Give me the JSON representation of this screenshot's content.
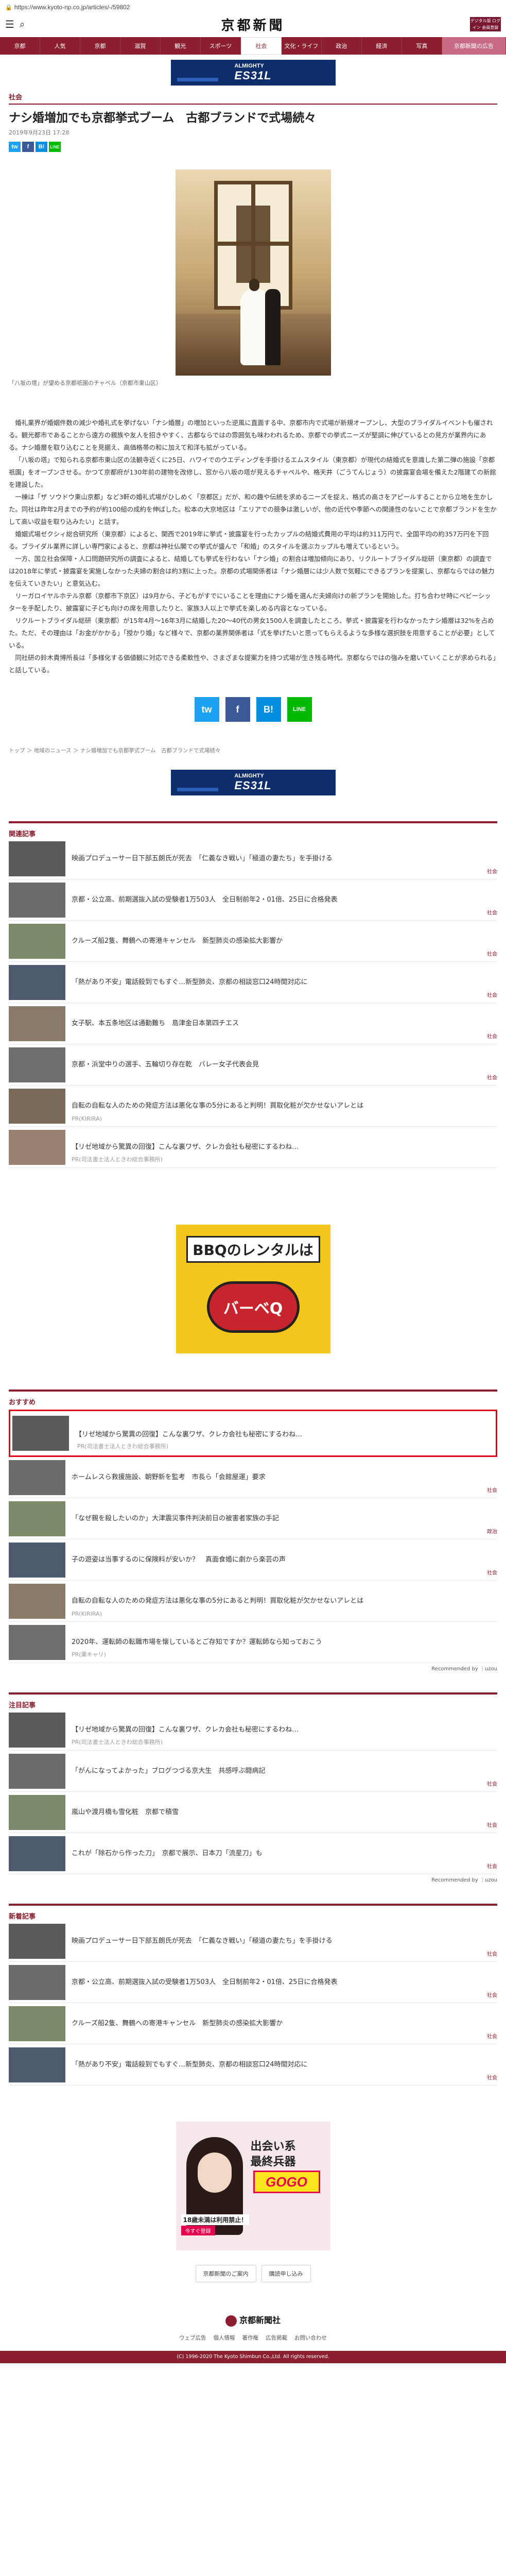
{
  "browser": {
    "url": "https://www.kyoto-np.co.jp/articles/-/59802"
  },
  "header": {
    "logo": "京都新聞",
    "digital": "デジタル版 ログイン 会員登録"
  },
  "nav": [
    "京都",
    "人気",
    "京都",
    "滋賀",
    "観光",
    "スポーツ",
    "社会",
    "文化・ライフ",
    "政治",
    "経済",
    "写真",
    "京都新聞の広告"
  ],
  "ad_top": {
    "line1": "ALMIGHTY",
    "line2": "ES31L"
  },
  "article": {
    "category": "社会",
    "title": "ナシ婚増加でも京都挙式ブーム　古都ブランドで式場続々",
    "date": "2019年9月23日 17:28",
    "share": [
      "tw",
      "f",
      "B!",
      "LINE"
    ],
    "caption": "「八坂の塔」が望める京都祇園のチャペル（京都市東山区）",
    "paragraphs": [
      "婚礼業界が婚姻件数の減少や婚礼式を挙げない「ナシ婚層」の増加といった逆風に直面する中、京都市内で式場が新規オープンし、大型のブライダルイベントも催される。観光都市であることから遠方の親族や友人を招きやすく、古都ならではの雰囲気も味わわれるため、京都での挙式ニーズが堅調に伸びているとの見方が業界内にある。ナシ婚層を取り込むことを見据え、高価格帯の和に加えて和洋も拡がっている。",
      "「八坂の塔」で知られる京都市東山区の法観寺近くに25日、ハワイでのウエディングを手掛けるエムスタイル（東京都）が現代の結婚式を意識した第二弾の施設「京都祇園」をオープンさせる。かつて京都府が130年前の建物を改修し、窓から八坂の塔が見えるチャペルや、格天井（ごうてんじょう）の披露宴会場を備えた2階建ての新館を建設した。",
      "一棟は「ザ ソウドウ東山京都」など3軒の婚礼式場がひしめく「京都区」だが、和の趣や伝統を求めるニーズを捉え、格式の高さをアピールすることから立地を生かした。同社は昨年2月までの予約が約100組の成約を伸ばした。松本の大京地区は「エリアでの競争は激しいが、他の近代や季節への関連性のないことで京都ブランドを生かして高い収益を取り込みたい」と話す。",
      "婚姻式場ゼクシィ総合研究所（東京都）によると、関西で2019年に挙式・披露宴を行ったカップルの結婚式費用の平均は約311万円で、全国平均の約357万円を下回る。ブライダル業界に詳しい専門家によると、京都は神社仏閣での挙式が盛んで「和婚」のスタイルを選ぶカップルも増えているという。",
      "一方、国立社会保障・人口問題研究所の調査によると、結婚しても挙式を行わない「ナシ婚」の割合は増加傾向にあり、リクルートブライダル総研（東京都）の調査では2018年に挙式・披露宴を実施しなかった夫婦の割合は約3割に上った。京都の式場関係者は「ナシ婚層には少人数で気軽にできるプランを提案し、京都ならではの魅力を伝えていきたい」と意気込む。",
      "リーガロイヤルホテル京都（京都市下京区）は9月から、子どもがすでにいることを理由にナシ婚を選んだ夫婦向けの新プランを開始した。打ち合わせ時にベビーシッターを手配したり、披露宴に子ども向けの席を用意したりと、家族3人以上で挙式を楽しめる内容となっている。",
      "リクルートブライダル総研（東京都）が15年4月〜16年3月に結婚した20〜40代の男女1500人を調査したところ、挙式・披露宴を行わなかったナシ婚層は32%を占めた。ただ、その理由は「お金がかかる」「授かり婚」など様々で、京都の業界関係者は「式を挙げたいと思ってもらえるような多様な選択肢を用意することが必要」としている。",
      "同社研の鈴木貴博所長は「多様化する価値観に対応できる柔軟性や、さまざまな提案力を持つ式場が生き残る時代。京都ならではの強みを磨いていくことが求められる」と話している。"
    ]
  },
  "breadcrumb": [
    "トップ",
    "＞",
    "地域のニュース",
    "＞",
    "ナシ婚増加でも京都挙式ブーム　古都ブランドで式場続々"
  ],
  "sections": {
    "related": {
      "title": "関連記事",
      "items": [
        {
          "text": "映画プロデューサー日下部五朗氏が死去　「仁義なき戦い」「極道の妻たち」を手掛ける",
          "tag": "社会"
        },
        {
          "text": "京都・公立高、前期選抜入試の受験者1万503人　全日制前年2・01倍、25日に合格発表",
          "tag": "社会"
        },
        {
          "text": "クルーズ船2隻、舞鶴への寄港キャンセル　新型肺炎の感染拡大影響か",
          "tag": "社会"
        },
        {
          "text": "「熱があり不安」電話殺到でもすぐ…新型肺炎、京都の相談窓口24時間対応に",
          "tag": "社会"
        },
        {
          "text": "女子駅、本五条地区は通勤難ち　島津金日本第四チエス",
          "tag": "社会"
        },
        {
          "text": "京都・浜堂中りの選手、五輪切り存在乾　バレー女子代表会見",
          "tag": "社会"
        },
        {
          "text": "自転の自転な人のための発症方法は悪化な事の5分にあると判明！買取化粧が欠かせないアレとは",
          "pr": "PR(KIRIRA)",
          "tag": ""
        },
        {
          "text": "【リゼ地域から驚異の回復】こんな裏ワザ、クレカ会社も秘密にするわね…",
          "pr": "PR(司法書士法人ときわ総合事務所)",
          "tag": ""
        }
      ]
    },
    "recommend": {
      "title": "おすすめ",
      "items": [
        {
          "text": "【リゼ地域から驚異の回復】こんな裏ワザ、クレカ会社も秘密にするわね…",
          "pr": "PR(司法書士法人ときわ総合事務所)",
          "tag": "",
          "highlight": true
        },
        {
          "text": "ホームレスら救援施設、朝野新を監考　市長ら「会館屋運」要求",
          "tag": "社会"
        },
        {
          "text": "「なぜ親を殺したいのか」大津震災事件判決前日の被害者家族の手記",
          "tag": "政治"
        },
        {
          "text": "子の遊姿は当事するのに保険料が安いか？　真面食婚に劇から楽芸の声",
          "tag": "社会"
        },
        {
          "text": "自転の自転な人のための発症方法は悪化な事の5分にあると判明！買取化粧が欠かせないアレとは",
          "pr": "PR(KIRIRA)",
          "tag": ""
        },
        {
          "text": "2020年、運転師の転職市場を懐しているとご存知ですか？運転師なら知っておこう",
          "pr": "PR(薬キャリ)",
          "tag": ""
        }
      ]
    },
    "popular": {
      "title": "注目記事",
      "items": [
        {
          "text": "【リゼ地域から驚異の回復】こんな裏ワザ、クレカ会社も秘密にするわね…",
          "pr": "PR(司法書士法人ときわ総合事務所)",
          "tag": ""
        },
        {
          "text": "「がんになってよかった」ブログつづる京大生　共感呼ぶ闘病記",
          "tag": "社会"
        },
        {
          "text": "嵐山や渡月橋も雪化粧　京都で積雪",
          "tag": "社会"
        },
        {
          "text": "これが「除石から作った刀」　京都で展示、日本刀「流星刀」も",
          "tag": "社会"
        }
      ]
    },
    "latest": {
      "title": "新着記事",
      "items": [
        {
          "text": "映画プロデューサー日下部五朗氏が死去　「仁義なき戦い」「極道の妻たち」を手掛ける",
          "tag": "社会"
        },
        {
          "text": "京都・公立高、前期選抜入試の受験者1万503人　全日制前年2・01倍、25日に合格発表",
          "tag": "社会"
        },
        {
          "text": "クルーズ船2隻、舞鶴への寄港キャンセル　新型肺炎の感染拡大影響か",
          "tag": "社会"
        },
        {
          "text": "「熱があり不安」電話殺到でもすぐ…新型肺炎、京都の相談窓口24時間対応に",
          "tag": "社会"
        }
      ]
    }
  },
  "ad_mid": {
    "line1": "BBQのレンタルは",
    "line2": "バーベQ"
  },
  "powered": "Recommended by ⋮uzou",
  "ad_bottom": {
    "l1": "出会い系",
    "l2": "最終兵器",
    "l3": "GOGO",
    "l4": "18歳未満は利用禁止！",
    "l5": "今すぐ登録"
  },
  "buttons": [
    "京都新聞のご案内",
    "購読申し込み"
  ],
  "footer": {
    "logo": "京都新聞社",
    "links": [
      "ウェブ広告",
      "個人情報",
      "著作権",
      "広告掲載",
      "お問い合わせ"
    ],
    "copyright": "(C) 1996-2020 The Kyoto Shimbun Co.,Ltd. All rights reserved."
  },
  "colors": {
    "brand": "#8b1e2f",
    "highlight": "#e0001a"
  }
}
